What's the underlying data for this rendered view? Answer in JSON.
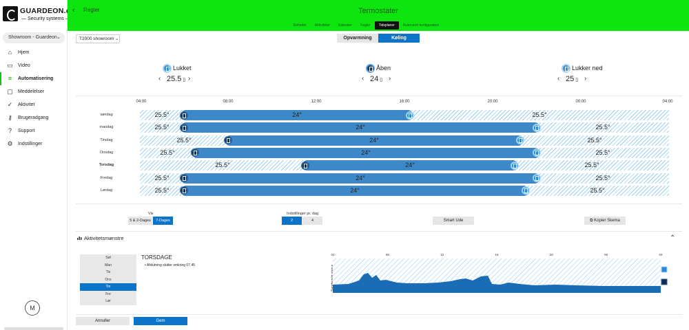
{
  "logo": {
    "brand": "GUARDEON.dk",
    "sub": "— Security systems —"
  },
  "site_select": {
    "value": "Showroom - Guardeon"
  },
  "nav": [
    {
      "label": "Hjem",
      "icon": "home-icon",
      "glyph": "⌂"
    },
    {
      "label": "Video",
      "icon": "video-camera-icon",
      "glyph": "▭"
    },
    {
      "label": "Automatisering",
      "icon": "automation-sliders-icon",
      "glyph": "≡",
      "active": true
    },
    {
      "label": "Meddelelser",
      "icon": "messages-icon",
      "glyph": "▢"
    },
    {
      "label": "Aktivitet",
      "icon": "activity-check-icon",
      "glyph": "✓"
    },
    {
      "label": "Brugeradgang",
      "icon": "user-access-icon",
      "glyph": "⚷"
    },
    {
      "label": "Support",
      "icon": "headset-icon",
      "glyph": "?"
    },
    {
      "label": "Indstillinger",
      "icon": "gear-icon",
      "glyph": "⚙"
    }
  ],
  "avatar": {
    "initial": "M"
  },
  "header": {
    "back_label": "Regler",
    "title": "Termostater",
    "tabs": [
      {
        "label": "Enheder"
      },
      {
        "label": "Aktiviteter"
      },
      {
        "label": "Kalender"
      },
      {
        "label": "Regler"
      },
      {
        "label": "Tidsplaner",
        "active": true
      },
      {
        "label": "Avanceret konfiguration"
      }
    ]
  },
  "thermostat_select": {
    "value": "T2000 showroom"
  },
  "mode_toggle": {
    "heating": "Opvarmning",
    "cooling": "Køling",
    "selected": "Køling"
  },
  "states": [
    {
      "label": "Lukket",
      "temp": "25.5",
      "unit": "▯",
      "icon": "door-closed-icon"
    },
    {
      "label": "Åben",
      "temp": "24",
      "unit": "▯",
      "icon": "door-open-icon"
    },
    {
      "label": "Lukker ned",
      "temp": "25",
      "unit": "▯",
      "icon": "shutdown-icon"
    }
  ],
  "time_axis": [
    "04:00",
    "08:00",
    "12:00",
    "16:00",
    "20:00",
    "00:00",
    "04:00"
  ],
  "schedule": [
    {
      "day": "søndag",
      "before": "25.5°",
      "active": "24°",
      "after": "25.5°"
    },
    {
      "day": "mandag",
      "before": "25.5°",
      "active": "24°",
      "after": "25.5°"
    },
    {
      "day": "Tirsdag",
      "before": "25.5°",
      "active": "24°",
      "after": "25.5°"
    },
    {
      "day": "Onsdag",
      "before": "25.5°",
      "active": "24°",
      "after": "25.5°"
    },
    {
      "day": "Torsdag",
      "before": "25.5°",
      "active": "24°",
      "after": "25.5°",
      "bold": true
    },
    {
      "day": "Fredag",
      "before": "25.5°",
      "active": "24°",
      "after": "25.5°"
    },
    {
      "day": "Lørdag",
      "before": "25.5°",
      "active": "24°",
      "after": "25.5°"
    }
  ],
  "view": {
    "label": "Vis",
    "options": [
      "5 & 2-Dages",
      "7-Dages"
    ],
    "selected": "7-Dages"
  },
  "settings_per_day": {
    "label": "Indstillinger pr. dag",
    "options": [
      "2",
      "4"
    ],
    "selected": "2"
  },
  "smart_ude": "Smart Ude",
  "copy_schedule": "Kopier Skema",
  "activity": {
    "title": "Aktivitetsmønstre",
    "days": [
      "Søl",
      "Man",
      "Tis",
      "Ons",
      "Tor",
      "Fre",
      "Lør"
    ],
    "selected_day": "Tor",
    "day_title": "TORSDAGE",
    "note": "Afslutning slutter omkring 07.45",
    "chart_ticks": [
      "04",
      "08",
      "12",
      "16",
      "20",
      "00",
      "04"
    ],
    "ylabel": "Sandsynlig status"
  },
  "buttons": {
    "cancel": "Annuller",
    "save": "Gem"
  },
  "colors": {
    "header_green": "#0ee40e",
    "accent_blue": "#0b74c8",
    "bar_blue": "#3c88c8"
  }
}
